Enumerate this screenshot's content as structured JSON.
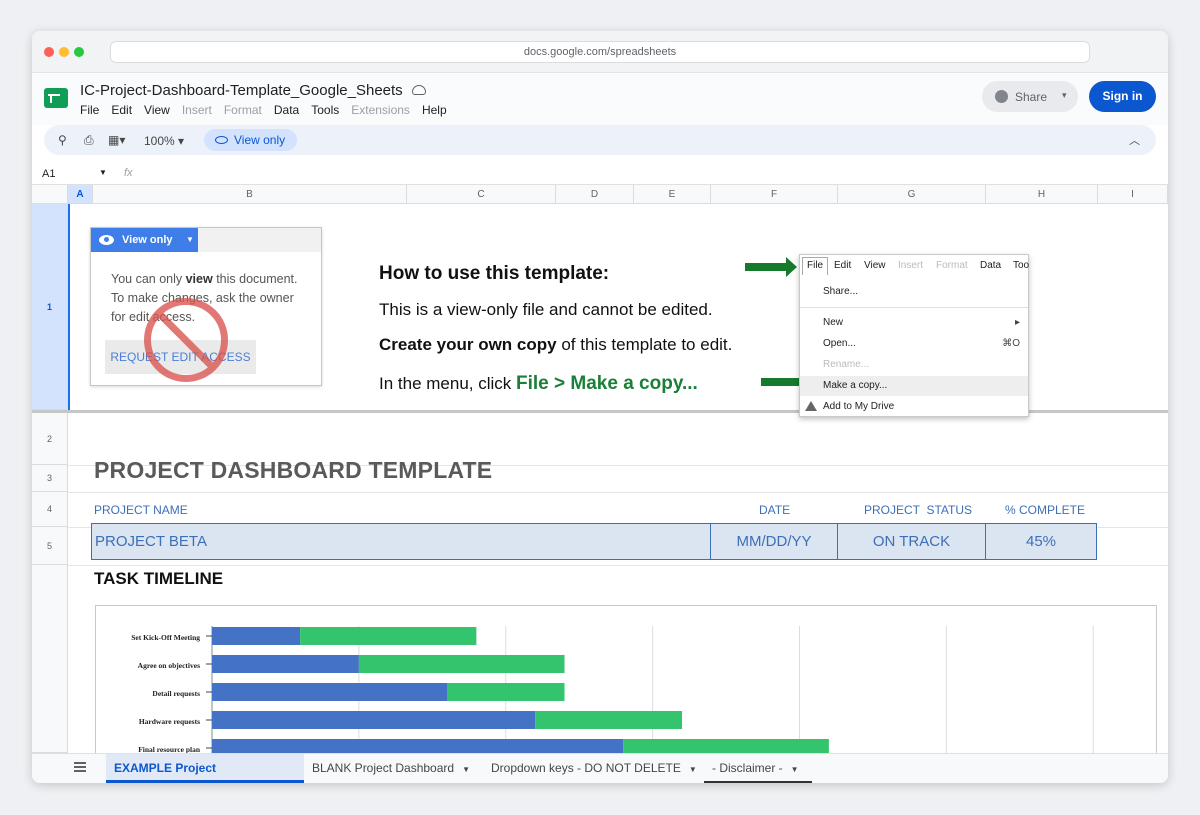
{
  "browser": {
    "url": "docs.google.com/spreadsheets"
  },
  "doc": {
    "title": "IC-Project-Dashboard-Template_Google_Sheets",
    "menu": [
      {
        "label": "File",
        "enabled": true
      },
      {
        "label": "Edit",
        "enabled": true
      },
      {
        "label": "View",
        "enabled": true
      },
      {
        "label": "Insert",
        "enabled": false
      },
      {
        "label": "Format",
        "enabled": false
      },
      {
        "label": "Data",
        "enabled": true
      },
      {
        "label": "Tools",
        "enabled": true
      },
      {
        "label": "Extensions",
        "enabled": false
      },
      {
        "label": "Help",
        "enabled": true
      }
    ],
    "share_label": "Share",
    "signin_label": "Sign in"
  },
  "toolbar": {
    "zoom": "100%",
    "view_only_label": "View only"
  },
  "formula_bar": {
    "cell_ref": "A1",
    "fx": "fx"
  },
  "columns": [
    "A",
    "B",
    "C",
    "D",
    "E",
    "F",
    "G",
    "H",
    "I"
  ],
  "rows": [
    "1",
    "2",
    "3",
    "4",
    "5"
  ],
  "instructions": {
    "card_button": "View only",
    "card_text_prefix": "You can only ",
    "card_text_bold": "view",
    "card_text_suffix": " this document. To make changes, ask the owner for edit access.",
    "request_button": "REQUEST EDIT ACCESS",
    "title": "How to use this template:",
    "line1": "This is a view-only file and cannot be edited.",
    "line2_bold": "Create your own copy",
    "line2_rest": " of this template to edit.",
    "line3_prefix": "In the menu, click ",
    "line3_green": "File > Make a copy...",
    "menu_shot": {
      "bar": [
        "File",
        "Edit",
        "View",
        "Insert",
        "Format",
        "Data",
        "Too"
      ],
      "share": "Share...",
      "new": "New",
      "new_arrow": "▸",
      "open": "Open...",
      "open_shortcut": "⌘O",
      "rename": "Rename...",
      "make_copy": "Make a copy...",
      "add_drive": "Add to My Drive"
    }
  },
  "dashboard": {
    "title": "PROJECT DASHBOARD TEMPLATE",
    "labels": {
      "name": "PROJECT NAME",
      "date": "DATE",
      "status": "PROJECT  STATUS",
      "complete": "% COMPLETE"
    },
    "values": {
      "name": "PROJECT BETA",
      "date": "MM/DD/YY",
      "status": "ON TRACK",
      "complete": "45%"
    },
    "task_title": "TASK TIMELINE"
  },
  "chart_data": {
    "type": "bar",
    "orientation": "horizontal-stacked",
    "categories": [
      "Set Kick-Off Meeting",
      "Agree on objectives",
      "Detail requests",
      "Hardware requests",
      "Final resource plan"
    ],
    "series": [
      {
        "values": [
          3,
          5,
          8,
          11,
          14
        ],
        "color": "#4472c4"
      },
      {
        "values": [
          6,
          7,
          4,
          5,
          7
        ],
        "color": "#33c46d"
      }
    ],
    "xlim": [
      0,
      32
    ],
    "grid": true
  },
  "sheet_tabs": [
    {
      "label": "EXAMPLE Project Dashboard",
      "active": true
    },
    {
      "label": "BLANK Project Dashboard",
      "active": false
    },
    {
      "label": "Dropdown keys - DO NOT DELETE",
      "active": false
    },
    {
      "label": "- Disclaimer -",
      "active": false
    }
  ]
}
